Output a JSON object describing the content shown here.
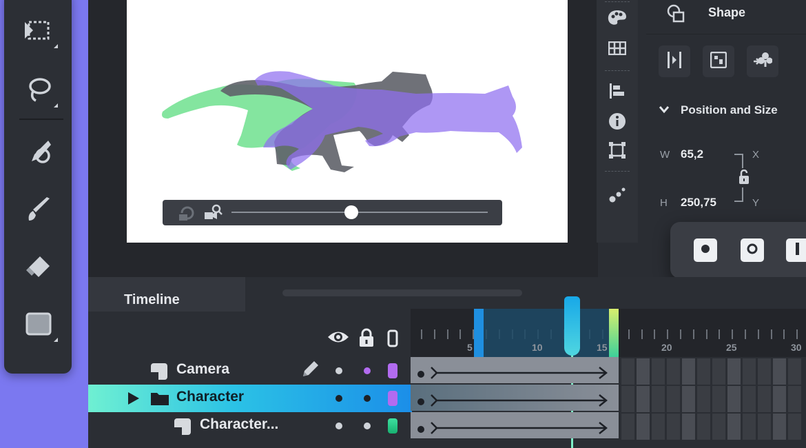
{
  "panel": {
    "title": "Shape",
    "section": "Position and Size",
    "w_label": "W",
    "w_value": "65,2",
    "h_label": "H",
    "h_value": "250,75",
    "x_label": "X",
    "y_label": "Y"
  },
  "timeline": {
    "title": "Timeline",
    "ruler_labels": [
      "5",
      "10",
      "15",
      "20",
      "25",
      "30"
    ],
    "playhead_frame": 12,
    "layers": [
      {
        "name": "Camera",
        "icon": "camera-layer-icon",
        "color": "#b26bf0",
        "selected": false
      },
      {
        "name": "Character",
        "icon": "folder-icon",
        "color": "#b26bf0",
        "selected": true
      },
      {
        "name": "Character...",
        "icon": "layer-icon",
        "color": "#22c98b",
        "selected": false
      }
    ]
  },
  "colors": {
    "accent": "#1fb4e6",
    "selection_start": "#5ee8d0",
    "silhouette_green": "#6ee08e",
    "silhouette_gray": "#6b6e75",
    "silhouette_purple": "#a98cf5",
    "backdrop": "#7b78f0"
  },
  "player": {
    "progress": 0.5
  }
}
